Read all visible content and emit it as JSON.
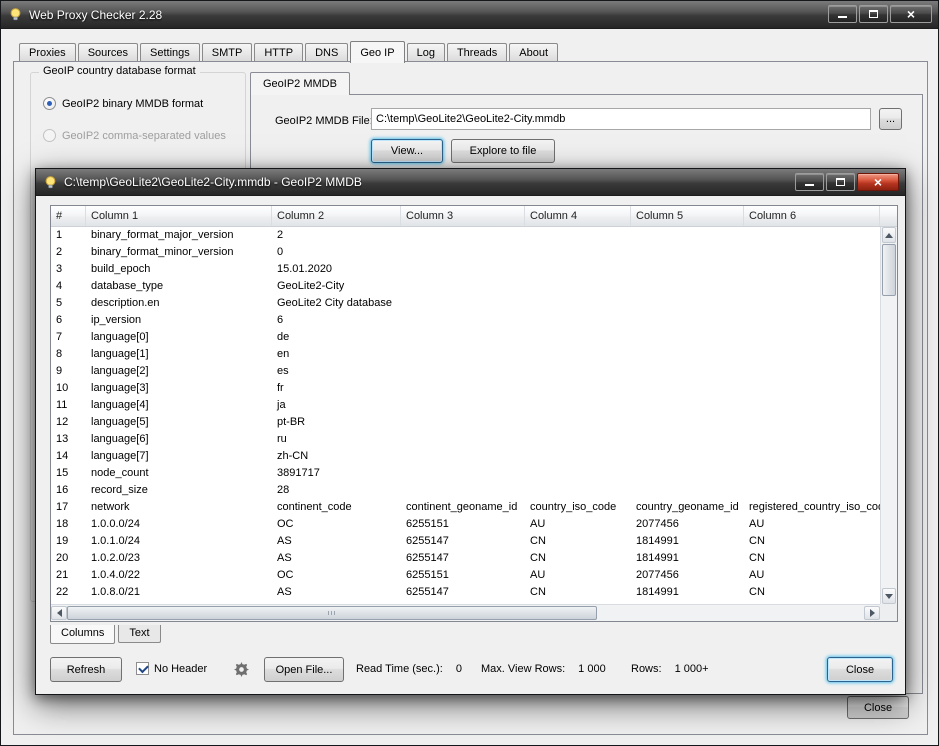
{
  "colors": {
    "focus_ring": "#3c7fb1",
    "close_button_red": "#c23b22",
    "radio_selected_blue": "#2f5fb8",
    "titlebar_dark": "#3a3a3a"
  },
  "window": {
    "title": "Web Proxy Checker 2.28",
    "tabs": [
      "Proxies",
      "Sources",
      "Settings",
      "SMTP",
      "HTTP",
      "DNS",
      "Geo IP",
      "Log",
      "Threads",
      "About"
    ]
  },
  "geoip": {
    "groupbox_title": "GeoIP country database format",
    "radio_mmdb_label": "GeoIP2 binary MMDB format",
    "radio_csv_label": "GeoIP2 comma-separated values",
    "subtab_label": "GeoIP2 MMDB",
    "file_label": "GeoIP2 MMDB File:",
    "file_value": "C:\\temp\\GeoLite2\\GeoLite2-City.mmdb",
    "browse_label": "...",
    "view_button": "View...",
    "explore_button": "Explore to file",
    "close_button": "Close"
  },
  "dialog": {
    "title": "C:\\temp\\GeoLite2\\GeoLite2-City.mmdb - GeoIP2 MMDB",
    "table": {
      "headers": [
        "#",
        "Column 1",
        "Column 2",
        "Column 3",
        "Column 4",
        "Column 5",
        "Column 6"
      ],
      "rows": [
        [
          "1",
          "binary_format_major_version",
          "2",
          "",
          "",
          "",
          ""
        ],
        [
          "2",
          "binary_format_minor_version",
          "0",
          "",
          "",
          "",
          ""
        ],
        [
          "3",
          "build_epoch",
          "15.01.2020",
          "",
          "",
          "",
          ""
        ],
        [
          "4",
          "database_type",
          "GeoLite2-City",
          "",
          "",
          "",
          ""
        ],
        [
          "5",
          "description.en",
          "GeoLite2 City database",
          "",
          "",
          "",
          ""
        ],
        [
          "6",
          "ip_version",
          "6",
          "",
          "",
          "",
          ""
        ],
        [
          "7",
          "language[0]",
          "de",
          "",
          "",
          "",
          ""
        ],
        [
          "8",
          "language[1]",
          "en",
          "",
          "",
          "",
          ""
        ],
        [
          "9",
          "language[2]",
          "es",
          "",
          "",
          "",
          ""
        ],
        [
          "10",
          "language[3]",
          "fr",
          "",
          "",
          "",
          ""
        ],
        [
          "11",
          "language[4]",
          "ja",
          "",
          "",
          "",
          ""
        ],
        [
          "12",
          "language[5]",
          "pt-BR",
          "",
          "",
          "",
          ""
        ],
        [
          "13",
          "language[6]",
          "ru",
          "",
          "",
          "",
          ""
        ],
        [
          "14",
          "language[7]",
          "zh-CN",
          "",
          "",
          "",
          ""
        ],
        [
          "15",
          "node_count",
          "3891717",
          "",
          "",
          "",
          ""
        ],
        [
          "16",
          "record_size",
          "28",
          "",
          "",
          "",
          ""
        ],
        [
          "17",
          "network",
          "continent_code",
          "continent_geoname_id",
          "country_iso_code",
          "country_geoname_id",
          "registered_country_iso_code"
        ],
        [
          "18",
          "1.0.0.0/24",
          "OC",
          "6255151",
          "AU",
          "2077456",
          "AU"
        ],
        [
          "19",
          "1.0.1.0/24",
          "AS",
          "6255147",
          "CN",
          "1814991",
          "CN"
        ],
        [
          "20",
          "1.0.2.0/23",
          "AS",
          "6255147",
          "CN",
          "1814991",
          "CN"
        ],
        [
          "21",
          "1.0.4.0/22",
          "OC",
          "6255151",
          "AU",
          "2077456",
          "AU"
        ],
        [
          "22",
          "1.0.8.0/21",
          "AS",
          "6255147",
          "CN",
          "1814991",
          "CN"
        ]
      ]
    },
    "tabs": [
      "Columns",
      "Text"
    ],
    "refresh_button": "Refresh",
    "no_header_label": "No Header",
    "open_file_button": "Open File...",
    "read_time_label": "Read Time (sec.):",
    "read_time_value": "0",
    "max_rows_label": "Max. View Rows:",
    "max_rows_value": "1 000",
    "rows_label": "Rows:",
    "rows_value": "1 000+",
    "close_button": "Close"
  }
}
